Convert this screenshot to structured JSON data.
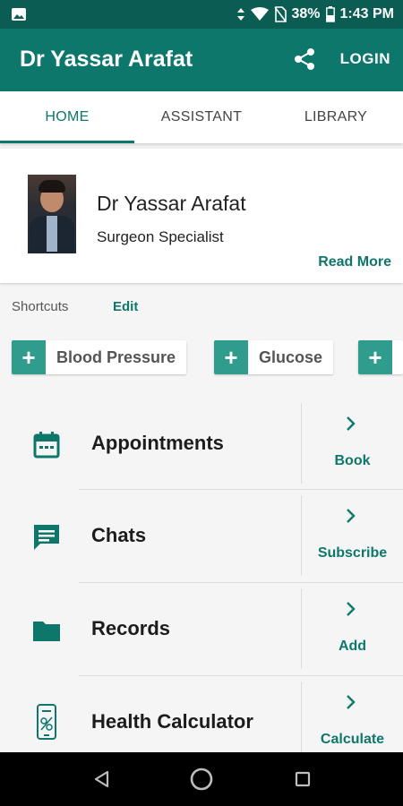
{
  "status_bar": {
    "battery": "38%",
    "time": "1:43 PM",
    "icons": [
      "image-icon",
      "data-arrows-icon",
      "wifi-icon",
      "no-sim-icon",
      "battery-icon"
    ]
  },
  "app_bar": {
    "title": "Dr Yassar Arafat",
    "share_icon": "share-icon",
    "login_label": "LOGIN"
  },
  "tabs": [
    {
      "label": "HOME",
      "active": true
    },
    {
      "label": "ASSISTANT",
      "active": false
    },
    {
      "label": "LIBRARY",
      "active": false
    }
  ],
  "profile": {
    "name": "Dr Yassar Arafat",
    "title": "Surgeon Specialist",
    "read_more": "Read More"
  },
  "shortcuts": {
    "label": "Shortcuts",
    "edit_label": "Edit",
    "chips": [
      {
        "plus": "+",
        "label": "Blood Pressure"
      },
      {
        "plus": "+",
        "label": "Glucose"
      },
      {
        "plus": "+",
        "label": ""
      }
    ]
  },
  "features": [
    {
      "title": "Appointments",
      "action": "Book",
      "icon": "calendar-icon"
    },
    {
      "title": "Chats",
      "action": "Subscribe",
      "icon": "chat-icon"
    },
    {
      "title": "Records",
      "action": "Add",
      "icon": "folder-icon"
    },
    {
      "title": "Health Calculator",
      "action": "Calculate",
      "icon": "phone-calculator-icon"
    }
  ],
  "nav_bar": {
    "icons": [
      "back-icon",
      "home-icon",
      "recents-icon"
    ]
  },
  "colors": {
    "primary": "#0e776c",
    "primary_dark": "#0b5c52",
    "chip_accent": "#2f9c8e",
    "background": "#f5f5f5"
  }
}
